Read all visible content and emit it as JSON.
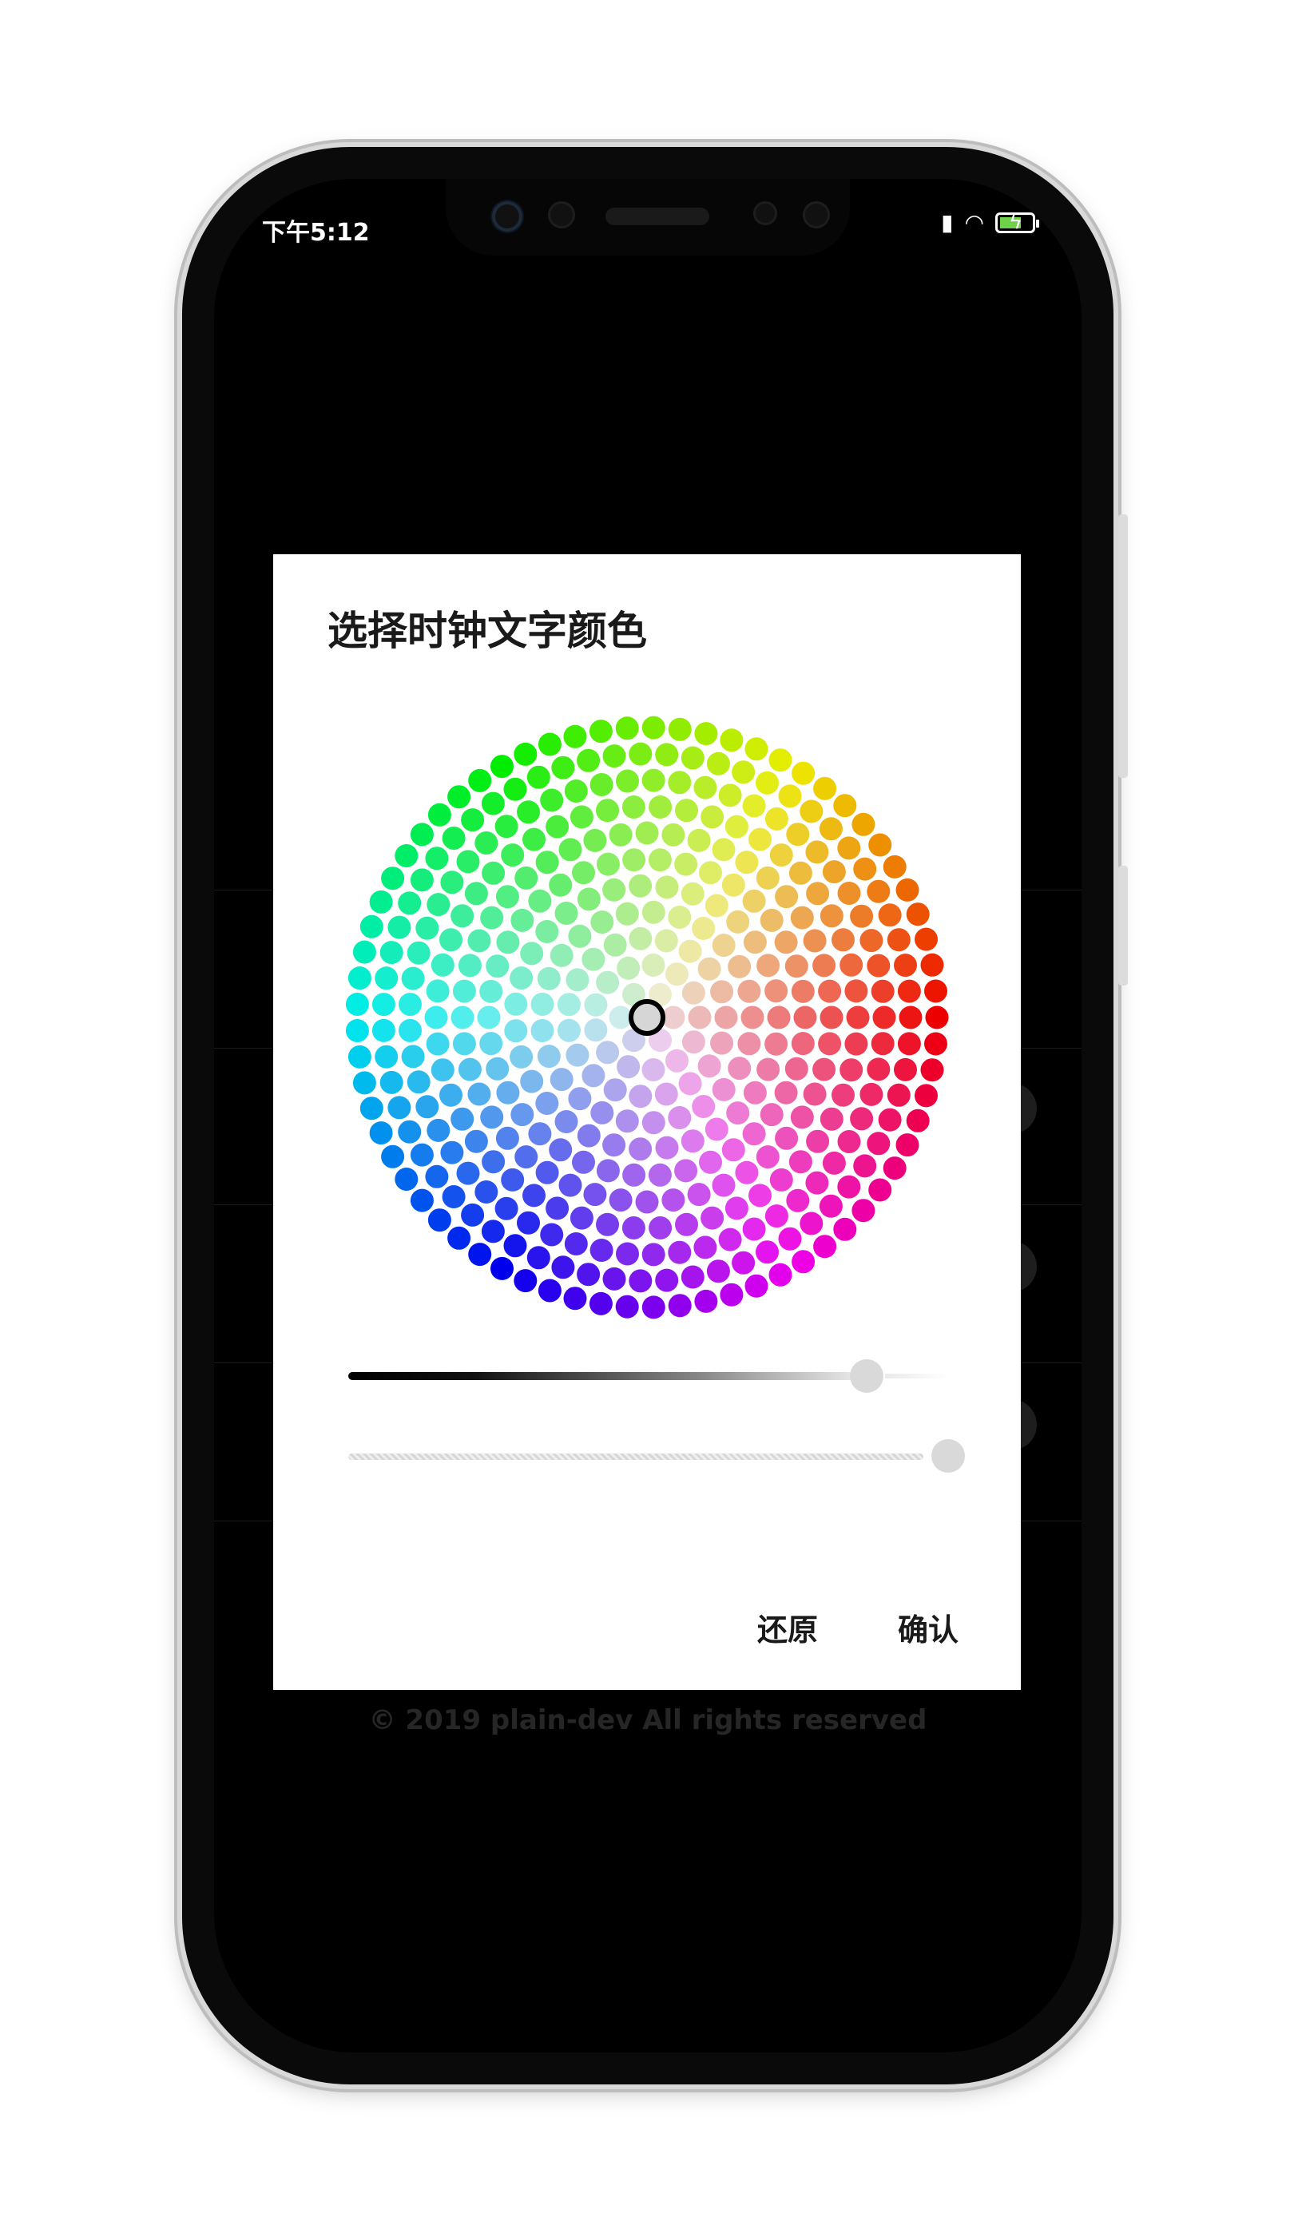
{
  "status_bar": {
    "time": "下午5:12",
    "icons": [
      "signal-icon",
      "wifi-icon",
      "battery-charging-icon"
    ],
    "battery_color": "#6fd14a"
  },
  "background": {
    "footer": "© 2019 plain-dev All rights reserved"
  },
  "dialog": {
    "title": "选择时钟文字颜色",
    "brightness_slider": {
      "value": 0.86
    },
    "alpha_slider": {
      "value": 1.0
    },
    "selected_color": "#d6d6d6",
    "buttons": {
      "reset": "还原",
      "confirm": "确认"
    }
  }
}
